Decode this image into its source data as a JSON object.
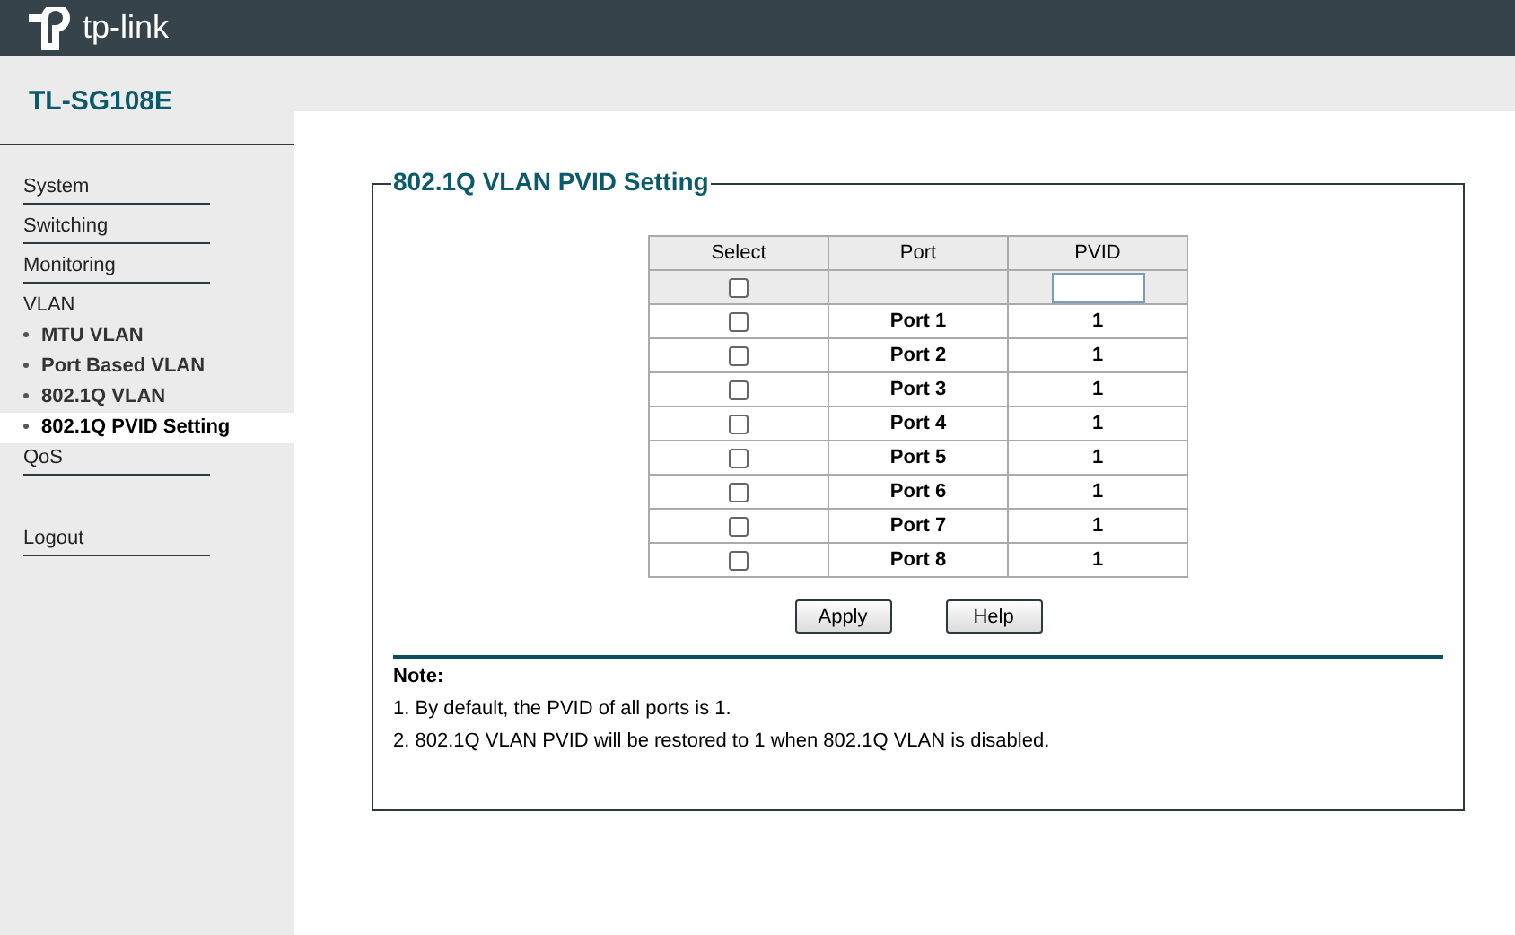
{
  "header": {
    "logo_text": "tp-link"
  },
  "model": "TL-SG108E",
  "sidebar": {
    "items": [
      {
        "label": "System",
        "kind": "section",
        "selected": false
      },
      {
        "label": "Switching",
        "kind": "section",
        "selected": false
      },
      {
        "label": "Monitoring",
        "kind": "section",
        "selected": false
      },
      {
        "label": "VLAN",
        "kind": "group",
        "selected": false
      },
      {
        "label": "MTU VLAN",
        "kind": "sub",
        "selected": false
      },
      {
        "label": "Port Based VLAN",
        "kind": "sub",
        "selected": false
      },
      {
        "label": "802.1Q VLAN",
        "kind": "sub",
        "selected": false
      },
      {
        "label": "802.1Q PVID Setting",
        "kind": "sub",
        "selected": true
      },
      {
        "label": "QoS",
        "kind": "section",
        "selected": false
      },
      {
        "label": "Logout",
        "kind": "logout",
        "selected": false
      }
    ]
  },
  "panel": {
    "title": "802.1Q VLAN PVID Setting",
    "table": {
      "columns": [
        "Select",
        "Port",
        "PVID"
      ],
      "batch_row": {
        "checked": false
      },
      "rows": [
        {
          "checked": false,
          "port": "Port 1",
          "pvid": "1"
        },
        {
          "checked": false,
          "port": "Port 2",
          "pvid": "1"
        },
        {
          "checked": false,
          "port": "Port 3",
          "pvid": "1"
        },
        {
          "checked": false,
          "port": "Port 4",
          "pvid": "1"
        },
        {
          "checked": false,
          "port": "Port 5",
          "pvid": "1"
        },
        {
          "checked": false,
          "port": "Port 6",
          "pvid": "1"
        },
        {
          "checked": false,
          "port": "Port 7",
          "pvid": "1"
        },
        {
          "checked": false,
          "port": "Port 8",
          "pvid": "1"
        }
      ]
    },
    "buttons": [
      "Apply",
      "Help"
    ],
    "note": {
      "title": "Note:",
      "lines": [
        "1. By default, the PVID of all ports is 1.",
        "2. 802.1Q VLAN PVID will be restored to 1 when 802.1Q VLAN is disabled."
      ]
    }
  }
}
